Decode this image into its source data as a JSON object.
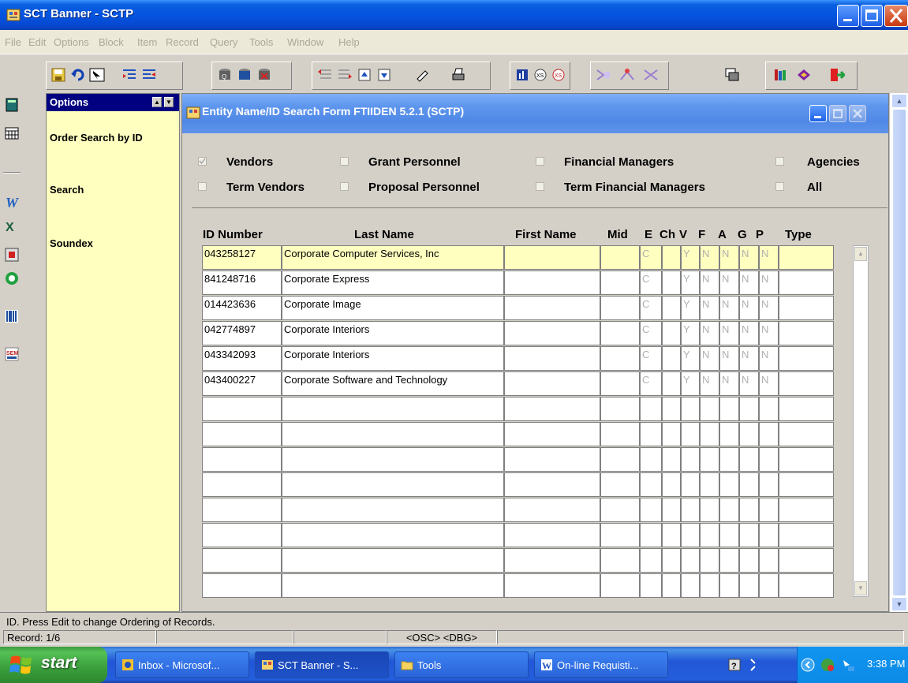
{
  "window": {
    "title": "SCT Banner - SCTP"
  },
  "menu": [
    "File",
    "Edit",
    "Options",
    "Block",
    "Item",
    "Record",
    "Query",
    "Tools",
    "Window",
    "Help"
  ],
  "options_panel": {
    "header": "Options",
    "items": [
      "Order Search by ID",
      "Search",
      "Soundex"
    ]
  },
  "form": {
    "title": "Entity Name/ID Search Form  FTIIDEN  5.2.1  (SCTP)",
    "filters": [
      {
        "label": "Vendors",
        "checked": true
      },
      {
        "label": "Grant Personnel",
        "checked": false
      },
      {
        "label": "Financial Managers",
        "checked": false
      },
      {
        "label": "Agencies",
        "checked": false
      },
      {
        "label": "Term Vendors",
        "checked": false
      },
      {
        "label": "Proposal Personnel",
        "checked": false
      },
      {
        "label": "Term Financial Managers",
        "checked": false
      },
      {
        "label": "All",
        "checked": false
      }
    ],
    "columns": [
      "ID Number",
      "Last Name",
      "First Name",
      "Mid",
      "E",
      "Ch",
      "V",
      "F",
      "A",
      "G",
      "P",
      "Type"
    ],
    "rows": [
      [
        "043258127",
        "Corporate Computer Services, Inc",
        "",
        "",
        "C",
        "",
        "Y",
        "N",
        "N",
        "N",
        "N",
        ""
      ],
      [
        "841248716",
        "Corporate Express",
        "",
        "",
        "C",
        "",
        "Y",
        "N",
        "N",
        "N",
        "N",
        ""
      ],
      [
        "014423636",
        "Corporate Image",
        "",
        "",
        "C",
        "",
        "Y",
        "N",
        "N",
        "N",
        "N",
        ""
      ],
      [
        "042774897",
        "Corporate Interiors",
        "",
        "",
        "C",
        "",
        "Y",
        "N",
        "N",
        "N",
        "N",
        ""
      ],
      [
        "043342093",
        "Corporate Interiors",
        "",
        "",
        "C",
        "",
        "Y",
        "N",
        "N",
        "N",
        "N",
        ""
      ],
      [
        "043400227",
        "Corporate Software and Technology",
        "",
        "",
        "C",
        "",
        "Y",
        "N",
        "N",
        "N",
        "N",
        ""
      ]
    ],
    "total_rows": 14
  },
  "status": {
    "message": "ID. Press Edit to change Ordering of Records.",
    "record": "Record: 1/6",
    "mode": "<OSC> <DBG>"
  },
  "taskbar": {
    "start": "start",
    "tasks": [
      "Inbox - Microsof...",
      "SCT Banner - S...",
      "Tools",
      "On-line Requisti..."
    ],
    "clock": "3:38 PM"
  }
}
